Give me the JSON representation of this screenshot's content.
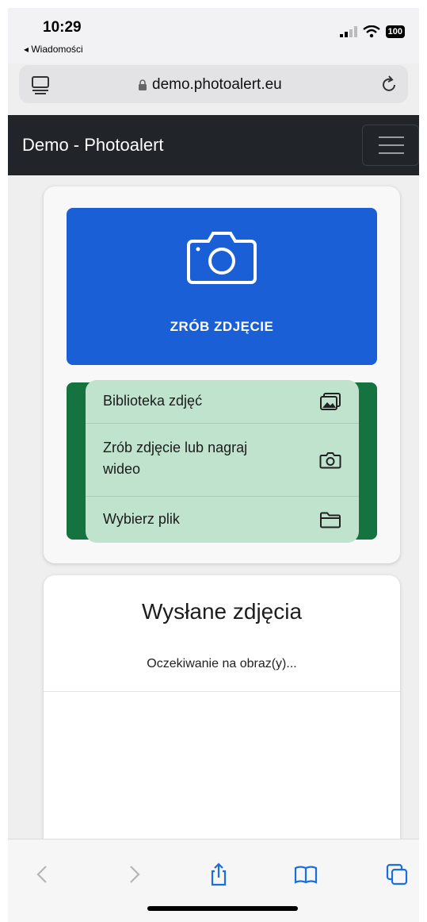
{
  "status_bar": {
    "time": "10:29",
    "back_app": "◂ Wiadomości",
    "battery": "100"
  },
  "browser": {
    "url": "demo.photoalert.eu",
    "icons": [
      "reader-icon",
      "lock-icon",
      "reload-icon"
    ]
  },
  "navbar": {
    "brand": "Demo - Photoalert",
    "toggler_icon": "hamburger-menu-icon",
    "bg_color": "#212529"
  },
  "upload_card": {
    "take_photo_label": "ZRÓB ZDJĘCIE",
    "take_photo_icon": "camera-icon",
    "primary_color": "#1a5fd6",
    "success_color": "#157340",
    "picker_menu": [
      {
        "label": "Biblioteka zdjęć",
        "icon": "photo-library-icon"
      },
      {
        "label": "Zrób zdjęcie lub nagraj wideo",
        "icon": "camera-icon"
      },
      {
        "label": "Wybierz plik",
        "icon": "folder-icon"
      }
    ]
  },
  "sent_photos": {
    "title": "Wysłane zdjęcia",
    "status": "Oczekiwanie na obraz(y)..."
  },
  "toolbar": {
    "icons": [
      "back-icon",
      "forward-icon",
      "share-icon",
      "bookmarks-icon",
      "tabs-icon"
    ]
  }
}
